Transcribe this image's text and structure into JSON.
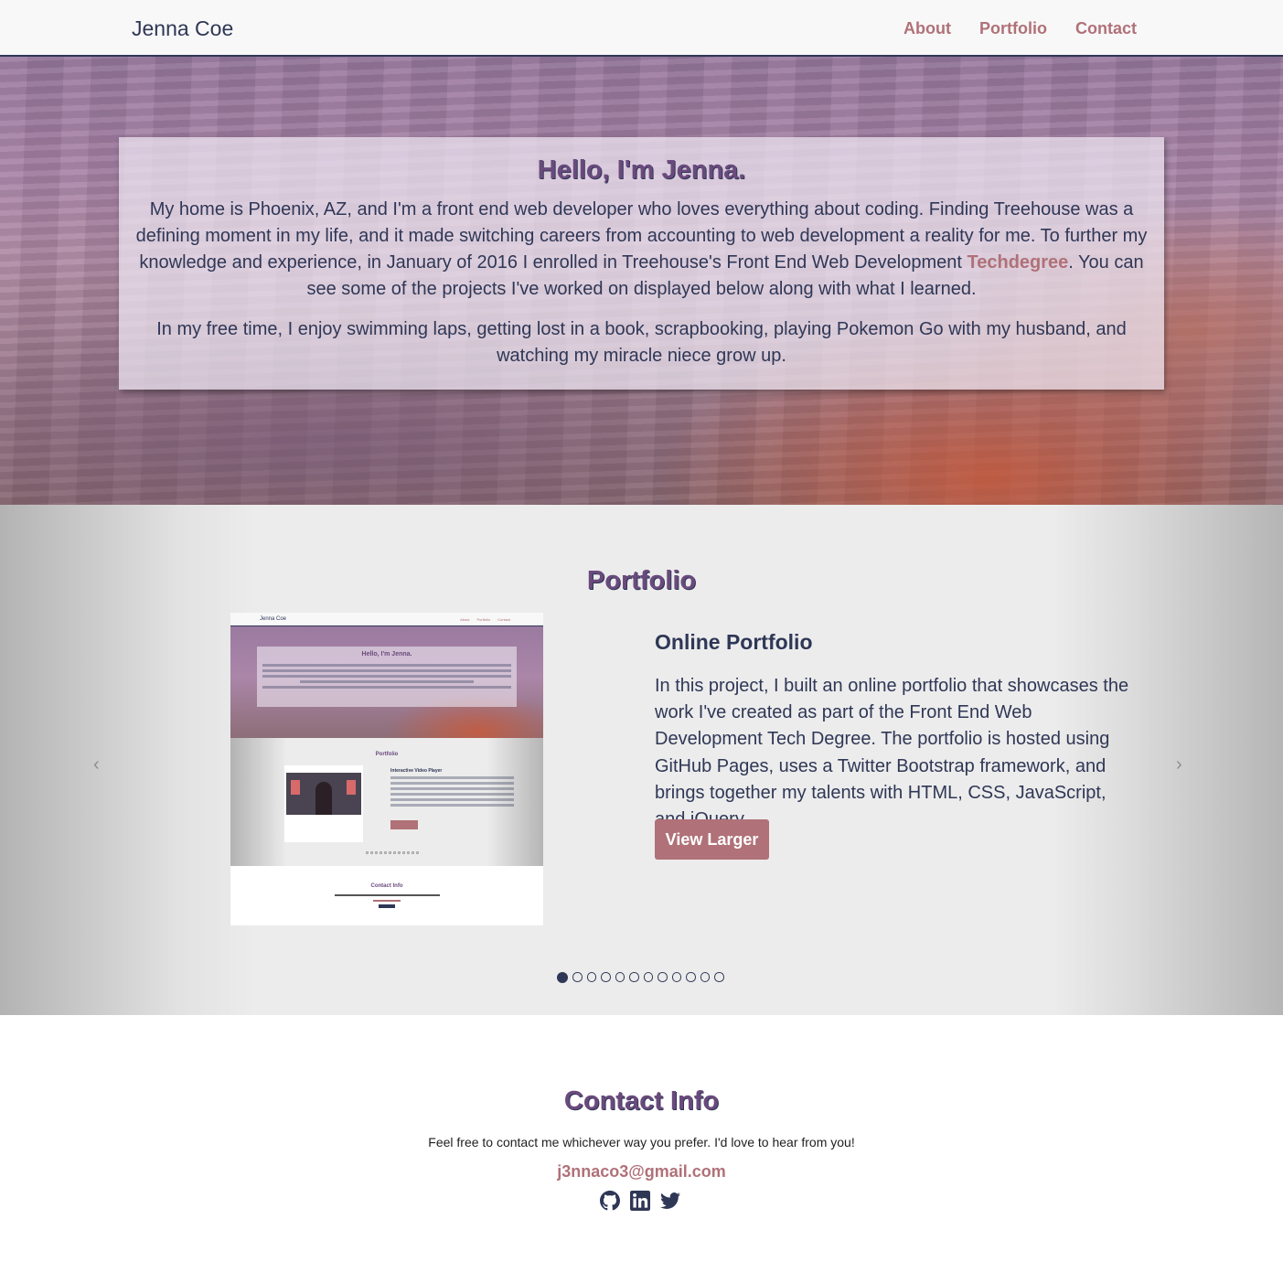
{
  "navbar": {
    "brand": "Jenna Coe",
    "links": [
      "About",
      "Portfolio",
      "Contact"
    ]
  },
  "hero": {
    "title": "Hello, I'm Jenna.",
    "para1_before": "My home is Phoenix, AZ, and I'm a front end web developer who loves everything about coding. Finding Treehouse was a defining moment in my life, and it made switching careers from accounting to web development a reality for me. To further my knowledge and experience, in January of 2016 I enrolled in Treehouse's Front End Web Development ",
    "para1_link": "Techdegree",
    "para1_after": ". You can see some of the projects I've worked on displayed below along with what I learned.",
    "para2": "In my free time, I enjoy swimming laps, getting lost in a book, scrapbooking, playing Pokemon Go with my husband, and watching my miracle niece grow up."
  },
  "portfolio": {
    "title": "Portfolio",
    "project_title": "Online Portfolio",
    "project_description": "In this project, I built an online portfolio that showcases the work I've created as part of the Front End Web Development Tech Degree. The portfolio is hosted using GitHub Pages, uses a Twitter Bootstrap framework, and brings together my talents with HTML, CSS, JavaScript, and jQuery.",
    "button_label": "View Larger",
    "prev_arrow": "‹",
    "next_arrow": "›",
    "slide_count": 12,
    "active_slide": 1,
    "thumbnail": {
      "brand": "Jenna Coe",
      "links": [
        "About",
        "Portfolio",
        "Contact"
      ],
      "hero_title": "Hello, I'm Jenna.",
      "section_title": "Portfolio",
      "project_title": "Interactive Video Player",
      "button_label": "View Larger",
      "contact_title": "Contact Info"
    }
  },
  "contact": {
    "title": "Contact Info",
    "text": "Feel free to contact me whichever way you prefer. I'd love to hear from you!",
    "email": "j3nnaco3@gmail.com",
    "icons": [
      "github-icon",
      "linkedin-icon",
      "twitter-icon"
    ]
  },
  "colors": {
    "navy": "#2f3756",
    "accent": "#b07178",
    "purple": "#6a4a7d"
  }
}
